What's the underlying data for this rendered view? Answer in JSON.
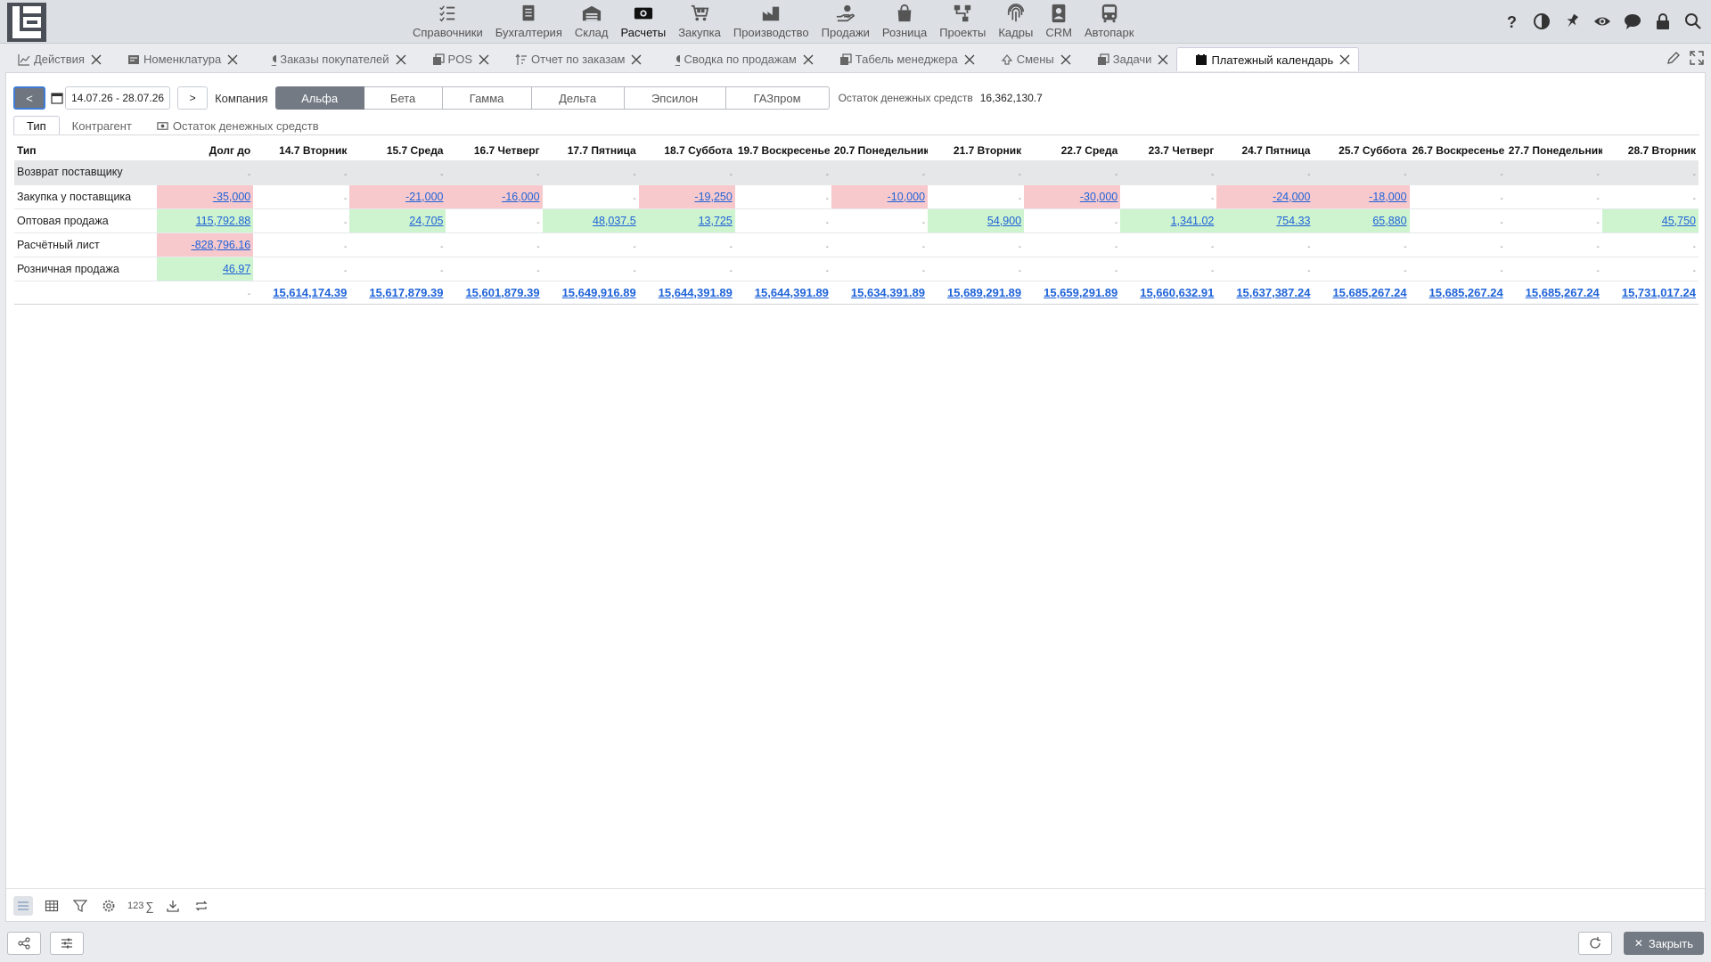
{
  "nav": {
    "items": [
      {
        "label": "Справочники",
        "icon": "checklist-icon"
      },
      {
        "label": "Бухгалтерия",
        "icon": "ledger-icon"
      },
      {
        "label": "Склад",
        "icon": "warehouse-icon"
      },
      {
        "label": "Расчеты",
        "icon": "money-icon",
        "active": true
      },
      {
        "label": "Закупка",
        "icon": "cart-icon"
      },
      {
        "label": "Производство",
        "icon": "factory-icon"
      },
      {
        "label": "Продажи",
        "icon": "hand-coin-icon"
      },
      {
        "label": "Розница",
        "icon": "bag-icon"
      },
      {
        "label": "Проекты",
        "icon": "network-icon"
      },
      {
        "label": "Кадры",
        "icon": "fingerprint-icon"
      },
      {
        "label": "CRM",
        "icon": "contact-icon"
      },
      {
        "label": "Автопарк",
        "icon": "bus-icon"
      }
    ]
  },
  "top_right_icons": [
    "help-icon",
    "contrast-icon",
    "pin-icon",
    "eye-icon",
    "chat-icon",
    "lock-icon",
    "search-icon"
  ],
  "tabs": [
    {
      "label": "Действия",
      "icon": "chart-icon"
    },
    {
      "label": "Номенклатура",
      "icon": "catalog-icon"
    },
    {
      "label": "Заказы покупателей",
      "icon": "hand-coin-icon"
    },
    {
      "label": "POS",
      "icon": "copy-icon"
    },
    {
      "label": "Отчет по заказам",
      "icon": "sort-icon"
    },
    {
      "label": "Сводка по продажам",
      "icon": "hand-coin-icon"
    },
    {
      "label": "Табель менеджера",
      "icon": "copy-icon"
    },
    {
      "label": "Смены",
      "icon": "shift-icon"
    },
    {
      "label": "Задачи",
      "icon": "copy-icon"
    },
    {
      "label": "Платежный календарь",
      "icon": "calendar-icon",
      "active": true
    }
  ],
  "toolbar": {
    "prev_label": "<",
    "date_range": "14.07.26 - 28.07.26",
    "next_label": ">",
    "company_label": "Компания",
    "companies": [
      "Альфа",
      "Бета",
      "Гамма",
      "Дельта",
      "Эпсилон",
      "ГАЗпром"
    ],
    "active_company": "Альфа",
    "balance_label": "Остаток денежных средств",
    "balance_value": "16,362,130.7"
  },
  "subtabs": [
    {
      "label": "Тип",
      "active": true
    },
    {
      "label": "Контрагент"
    },
    {
      "label": "Остаток денежных средств",
      "icon": "cash-icon"
    }
  ],
  "grid": {
    "headers": [
      "Тип",
      "Долг до",
      "14.7 Вторник",
      "15.7 Среда",
      "16.7 Четверг",
      "17.7 Пятница",
      "18.7 Суббота",
      "19.7 Воскресенье",
      "20.7 Понедельник",
      "21.7 Вторник",
      "22.7 Среда",
      "23.7 Четверг",
      "24.7 Пятница",
      "25.7 Суббота",
      "26.7 Воскресенье",
      "27.7 Понедельник",
      "28.7 Вторник"
    ],
    "rows": [
      {
        "type": "Возврат поставщику",
        "group": true,
        "cells": [
          "-",
          "-",
          "-",
          "-",
          "-",
          "-",
          "-",
          "-",
          "-",
          "-",
          "-",
          "-",
          "-",
          "-",
          "-",
          "-"
        ]
      },
      {
        "type": "Закупка у поставщика",
        "cells": [
          "-35,000",
          "-",
          "-21,000",
          "-16,000",
          "-",
          "-19,250",
          "-",
          "-10,000",
          "-",
          "-30,000",
          "-",
          "-24,000",
          "-18,000",
          "-",
          "-",
          "-"
        ]
      },
      {
        "type": "Оптовая продажа",
        "cells": [
          "115,792.88",
          "-",
          "24,705",
          "-",
          "48,037.5",
          "13,725",
          "-",
          "-",
          "54,900",
          "-",
          "1,341.02",
          "754.33",
          "65,880",
          "-",
          "-",
          "45,750"
        ]
      },
      {
        "type": "Расчётный лист",
        "cells": [
          "-828,796.16",
          "-",
          "-",
          "-",
          "-",
          "-",
          "-",
          "-",
          "-",
          "-",
          "-",
          "-",
          "-",
          "-",
          "-",
          "-"
        ]
      },
      {
        "type": "Розничная продажа",
        "cells": [
          "46.97",
          "-",
          "-",
          "-",
          "-",
          "-",
          "-",
          "-",
          "-",
          "-",
          "-",
          "-",
          "-",
          "-",
          "-",
          "-"
        ]
      }
    ],
    "totals": [
      "-",
      "15,614,174.39",
      "15,617,879.39",
      "15,601,879.39",
      "15,649,916.89",
      "15,644,391.89",
      "15,644,391.89",
      "15,634,391.89",
      "15,689,291.89",
      "15,659,291.89",
      "15,660,632.91",
      "15,637,387.24",
      "15,685,267.24",
      "15,685,267.24",
      "15,685,267.24",
      "15,731,017.24"
    ]
  },
  "bottom_tools": {
    "number_label": "123",
    "sum_label": "∑"
  },
  "footer": {
    "close_label": "Закрыть"
  },
  "colors": {
    "negative_bg": "#f7c9cc",
    "positive_bg": "#cdf3cf",
    "link": "#1f63d8",
    "active_segment": "#737a84"
  }
}
